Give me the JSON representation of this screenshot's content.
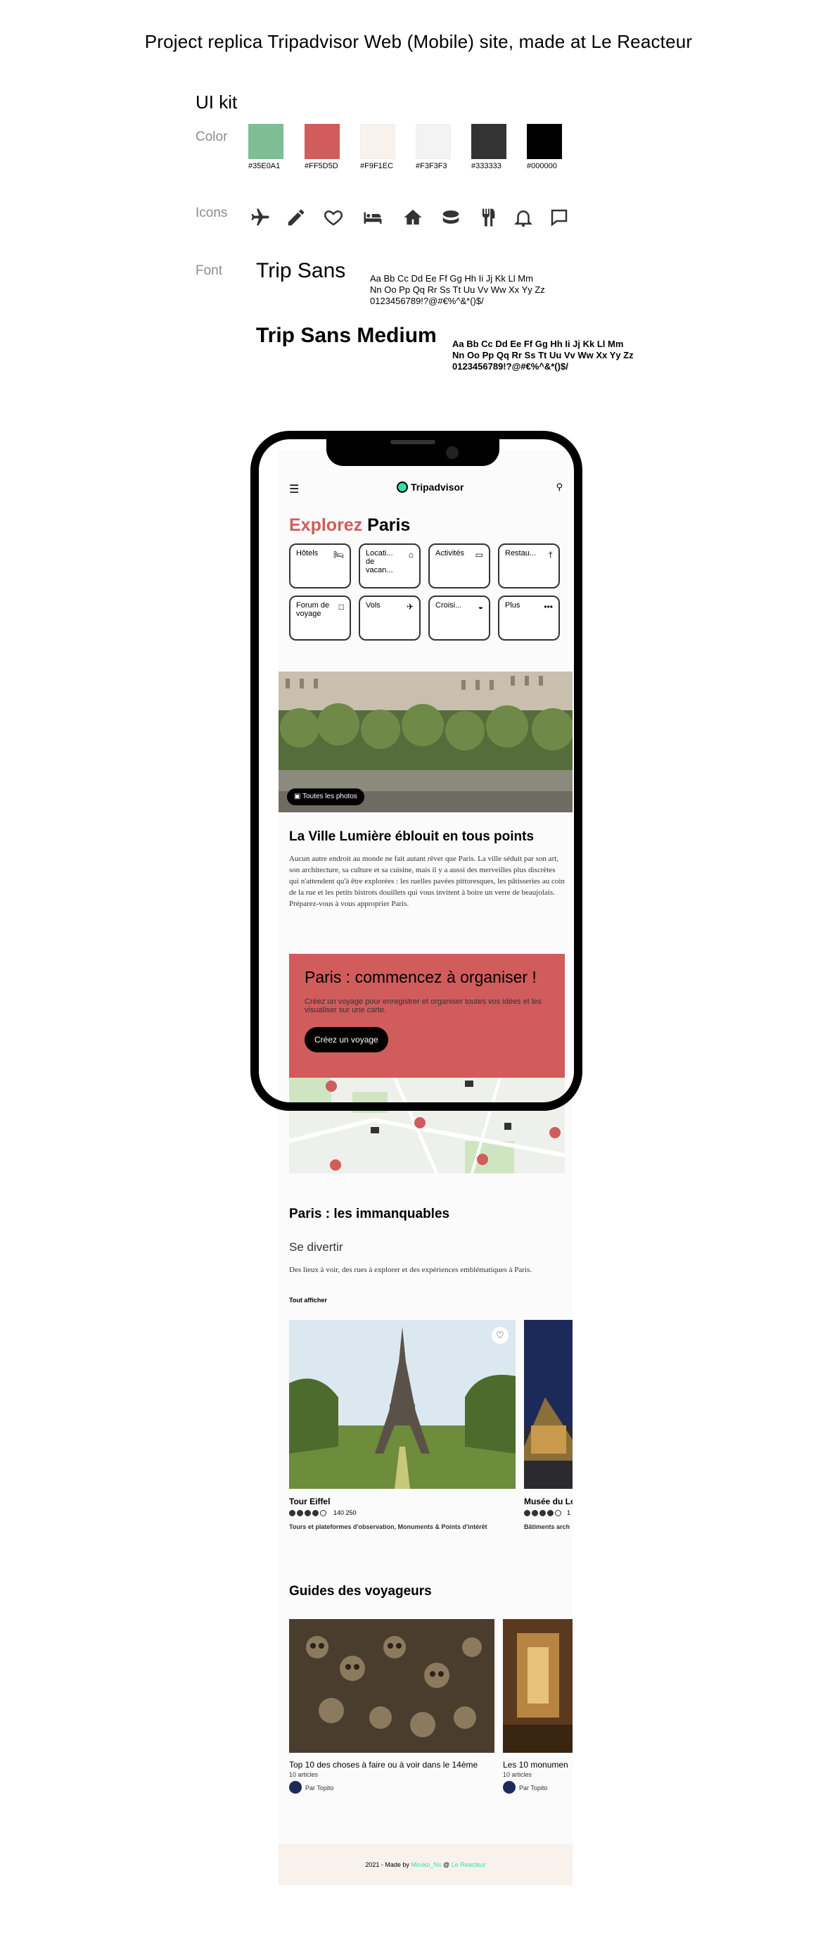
{
  "page": {
    "title": "Project replica Tripadvisor Web (Mobile) site, made at Le Reacteur"
  },
  "uikit": {
    "title": "UI kit",
    "color_label": "Color",
    "icons_label": "Icons",
    "font_label": "Font",
    "colors": [
      {
        "hex": "#35E0A1",
        "fill": "#7fbd94"
      },
      {
        "hex": "#FF5D5D",
        "fill": "#d05c5c"
      },
      {
        "hex": "#F9F1EC",
        "fill": "#f9f1ec"
      },
      {
        "hex": "#F3F3F3",
        "fill": "#f3f3f3"
      },
      {
        "hex": "#333333",
        "fill": "#333333"
      },
      {
        "hex": "#000000",
        "fill": "#000000"
      }
    ],
    "icons": [
      "plane-icon",
      "pencil-icon",
      "heart-icon",
      "bed-icon",
      "home-icon",
      "cruise-icon",
      "restaurant-icon",
      "bell-icon",
      "chat-icon"
    ],
    "font_regular_name": "Trip Sans",
    "font_medium_name": "Trip Sans Medium",
    "font_sample": "Aa Bb Cc Dd Ee Ff Gg Hh Ii Jj Kk Ll Mm\nNn Oo Pp Qq Rr Ss Tt Uu Vv Ww Xx Yy Zz\n0123456789!?@#€%^&*()$/"
  },
  "app": {
    "logo": "Tripadvisor",
    "explore_prefix": "Explorez",
    "explore_city": "Paris",
    "categories": [
      {
        "label": "Hôtels",
        "icon": "bed-icon"
      },
      {
        "label": "Locati... de vacan...",
        "icon": "home-icon"
      },
      {
        "label": "Activités",
        "icon": "ticket-icon"
      },
      {
        "label": "Restau...",
        "icon": "restaurant-icon"
      },
      {
        "label": "Forum de voyage",
        "icon": "chat-icon"
      },
      {
        "label": "Vols",
        "icon": "plane-icon"
      },
      {
        "label": "Croisi...",
        "icon": "cruise-icon"
      },
      {
        "label": "Plus",
        "icon": "more-icon"
      }
    ],
    "photos_button": "Toutes les photos",
    "intro_title": "La Ville Lumière éblouit en tous points",
    "intro_text": "Aucun autre endroit au monde ne fait autant rêver que Paris. La ville séduit par son art, son architecture, sa culture et sa cuisine, mais il y a aussi des merveilles plus discrètes qui n'attendent qu'à être explorées : les ruelles pavées pittoresques, les pâtisseries au coin de la rue et les petits bistrots douillets qui vous invitent à boire un verre de beaujolais. Préparez-vous à vous approprier Paris.",
    "promo_title": "Paris : commencez à organiser !",
    "promo_text": "Créez un voyage pour enregistrer et organiser toutes vos idées et les visualiser sur une carte.",
    "promo_button": "Créez un voyage",
    "must_see_title": "Paris : les immanquables",
    "fun_title": "Se divertir",
    "fun_text": "Des lieux à voir, des rues à explorer et des expériences emblématiques à Paris.",
    "see_all": "Tout afficher",
    "attractions": [
      {
        "name": "Tour Eiffel",
        "rating": 4,
        "reviews": "140 250",
        "tags": "Tours et plateformes d'observation, Monuments & Points d'intérêt"
      },
      {
        "name": "Musée du Lo",
        "rating": 4,
        "reviews": "1",
        "tags": "Bâtiments arch"
      }
    ],
    "guides_title": "Guides des voyageurs",
    "guides": [
      {
        "title": "Top 10 des choses à faire ou à voir dans le 14ème",
        "count": "10 articles",
        "author": "Par Topito"
      },
      {
        "title": "Les 10 monumen",
        "count": "10 articles",
        "author": "Par Topito"
      }
    ],
    "footer_prefix": "2021 - Made by",
    "footer_author": "Miruko_Ns",
    "footer_at": "@",
    "footer_school": "Le Reacteur"
  }
}
